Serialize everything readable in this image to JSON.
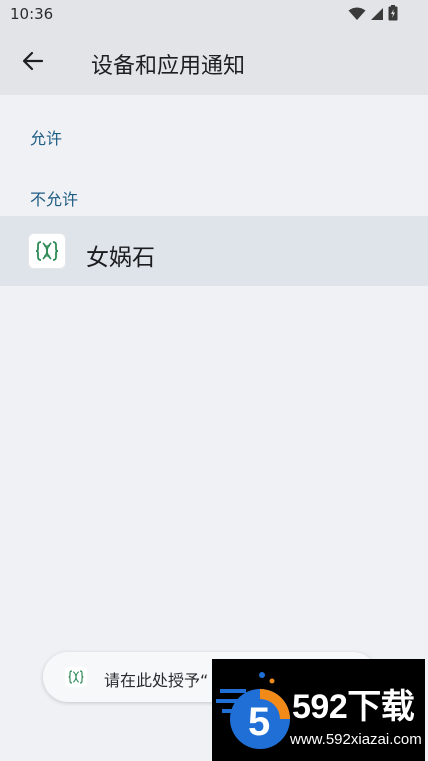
{
  "status_bar": {
    "time": "10:36",
    "icons": [
      "wifi-icon",
      "signal-icon",
      "battery-icon"
    ]
  },
  "app_bar": {
    "title": "设备和应用通知",
    "back_icon": "arrow-back-icon"
  },
  "sections": {
    "allowed_header": "允许",
    "not_allowed_header": "不允许"
  },
  "apps": [
    {
      "name": "女娲石",
      "icon": "dna-app-icon"
    }
  ],
  "toast": {
    "text": "请在此处授予“",
    "icon": "dna-app-icon"
  },
  "watermark": {
    "logo_text": "592下载",
    "url": "www.592xiazai.com",
    "colors": {
      "background": "#000000",
      "accent_blue": "#1f6fd6",
      "accent_orange": "#f28a1a"
    }
  },
  "colors": {
    "background": "#eff1f5",
    "appbar": "#e2e4e8",
    "row_highlight": "#dfe3ea",
    "section_header": "#1f5c82",
    "dna_green": "#2e8b57"
  }
}
